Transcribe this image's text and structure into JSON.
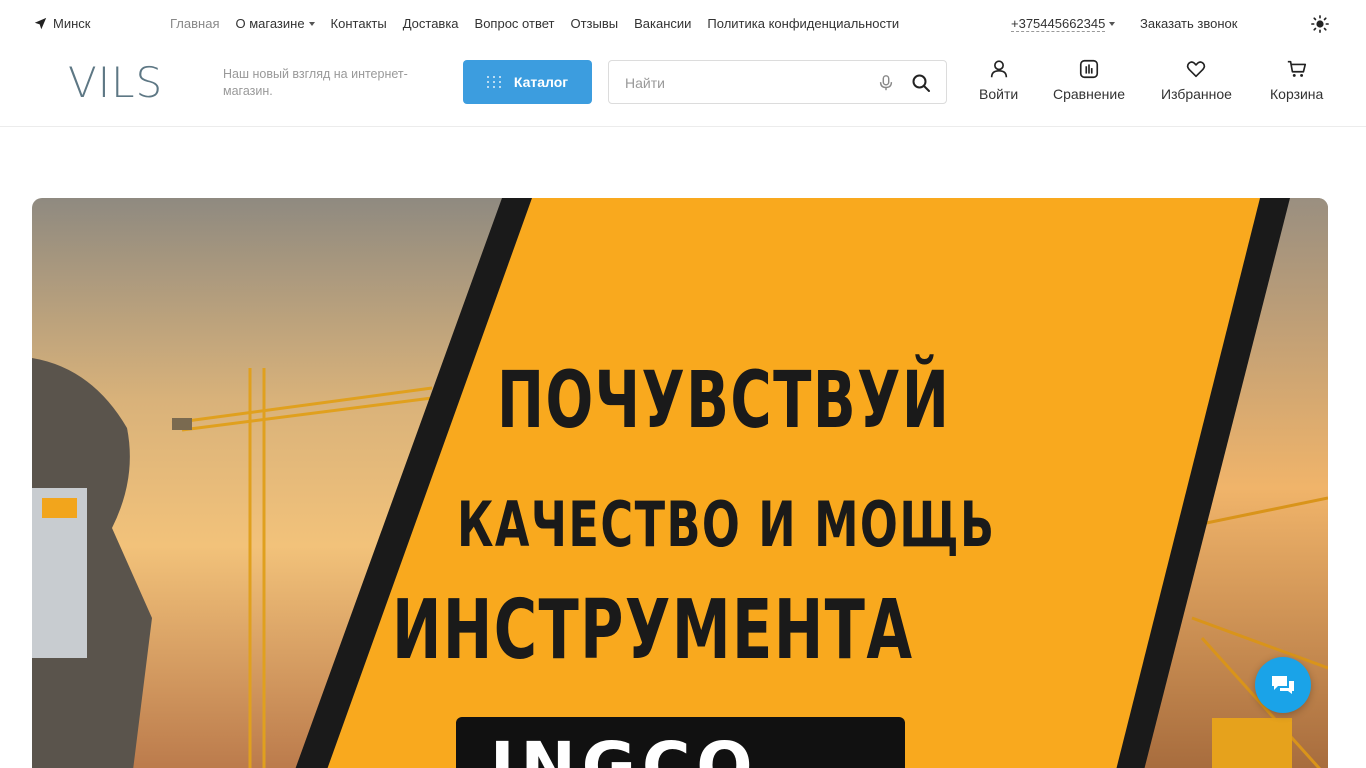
{
  "topbar": {
    "city": "Минск",
    "nav": [
      {
        "label": "Главная"
      },
      {
        "label": "О магазине"
      },
      {
        "label": "Контакты"
      },
      {
        "label": "Доставка"
      },
      {
        "label": "Вопрос ответ"
      },
      {
        "label": "Отзывы"
      },
      {
        "label": "Вакансии"
      },
      {
        "label": "Политика конфиденциальности"
      }
    ],
    "phone": "+375445662345",
    "callback": "Заказать звонок"
  },
  "header": {
    "logo": "VILS",
    "slogan": "Наш новый взгляд на интернет-магазин.",
    "catalog_label": "Каталог",
    "search_placeholder": "Найти",
    "actions": {
      "login": "Войти",
      "compare": "Сравнение",
      "favorites": "Избранное",
      "cart": "Корзина"
    }
  },
  "banner": {
    "line1": "ПОЧУВСТВУЙ",
    "line2": "КАЧЕСТВО И МОЩЬ",
    "line3": "ИНСТРУМЕНТА",
    "brand": "INGCO",
    "accent_color": "#f5a623"
  },
  "colors": {
    "primary": "#3c9ddf",
    "chat": "#1aa3e8",
    "logo": "#5d7784"
  }
}
